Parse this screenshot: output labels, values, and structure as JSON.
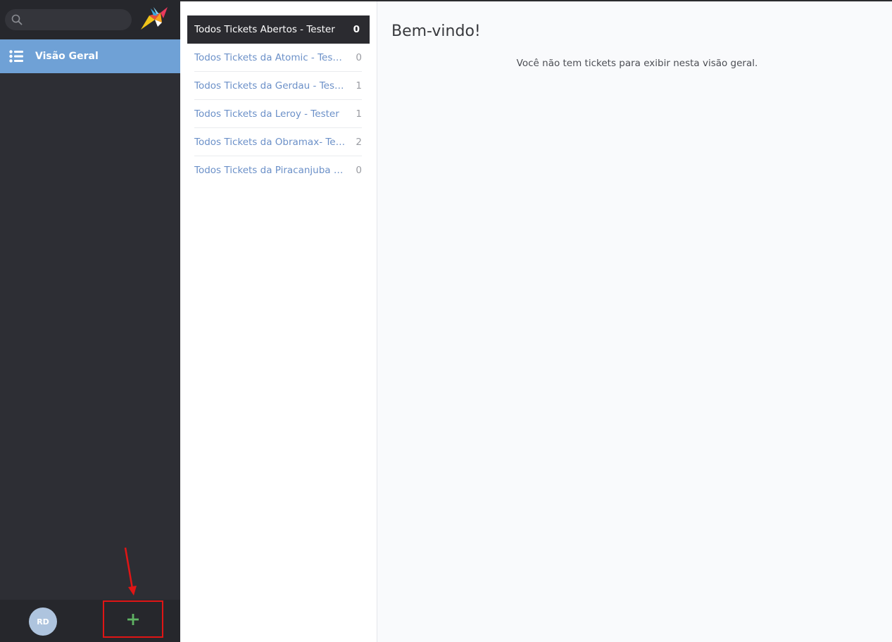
{
  "search": {
    "placeholder": ""
  },
  "nav": {
    "items": [
      {
        "label": "Visão Geral",
        "icon": "list-icon"
      }
    ]
  },
  "user": {
    "initials": "RD"
  },
  "actions": {
    "add_icon": "plus-icon"
  },
  "overviews": [
    {
      "label": "Todos Tickets Abertos - Tester",
      "count": "0"
    },
    {
      "label": "Todos Tickets da Atomic - Tester",
      "count": "0"
    },
    {
      "label": "Todos Tickets da Gerdau - Tester",
      "count": "1"
    },
    {
      "label": "Todos Tickets da Leroy - Tester",
      "count": "1"
    },
    {
      "label": "Todos Tickets da Obramax- Tester",
      "count": "2"
    },
    {
      "label": "Todos Tickets da Piracanjuba - T...",
      "count": "0"
    }
  ],
  "main": {
    "title": "Bem-vindo!",
    "empty_message": "Você não tem tickets para exibir nesta visão geral."
  },
  "colors": {
    "sidebar_bg": "#2d2e34",
    "nav_active": "#6fa1d6",
    "link": "#6b90c8",
    "plus": "#5fb363",
    "annotation": "#e01515"
  }
}
